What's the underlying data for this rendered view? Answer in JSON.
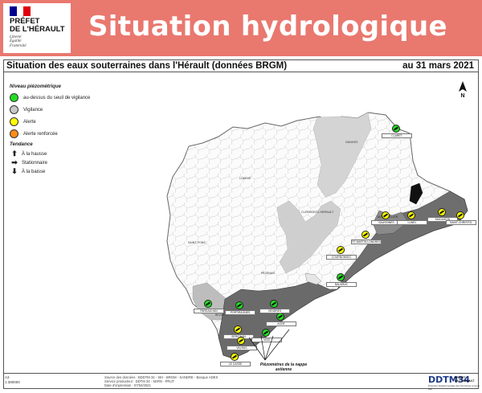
{
  "header": {
    "logo_lines": [
      "PRÉFET",
      "DE L'HÉRAULT"
    ],
    "logo_motto": [
      "Liberté",
      "Égalité",
      "Fraternité"
    ],
    "banner_title": "Situation hydrologique",
    "colors": {
      "banner": "#e9786f",
      "flag_blue": "#000091",
      "flag_red": "#e1000f"
    }
  },
  "map": {
    "title": "Situation des eaux souterraines dans l'Hérault (données BRGM)",
    "date": "au 31 mars 2021",
    "north_label": "N"
  },
  "legend": {
    "level_title": "Niveau piézométrique",
    "levels": [
      {
        "label": "au-dessus du seuil de vigilance",
        "color": "#22dd22"
      },
      {
        "label": "Vigilance",
        "color": "#c8c8c8"
      },
      {
        "label": "Alerte",
        "color": "#ffff00"
      },
      {
        "label": "Alerte renforcée",
        "color": "#ff8c1a"
      }
    ],
    "trend_title": "Tendance",
    "trends": [
      {
        "label": "À la hausse",
        "glyph": "⬆"
      },
      {
        "label": "Stationnaire",
        "glyph": "➡"
      },
      {
        "label": "À la baisse",
        "glyph": "⬇"
      }
    ]
  },
  "stations": [
    {
      "label": "CLARET",
      "status": "green"
    },
    {
      "label": "SAUSSINES",
      "status": "yellow"
    },
    {
      "label": "LUNEL",
      "status": "yellow"
    },
    {
      "label": "MUDAISON",
      "status": "yellow"
    },
    {
      "label": "SAINT-CHRISTOL",
      "status": "yellow"
    },
    {
      "label": "ST MARTIN LONDRES",
      "status": "yellow"
    },
    {
      "label": "COURNONSEC",
      "status": "yellow"
    },
    {
      "label": "BALARUC",
      "status": "green"
    },
    {
      "label": "PARDAILHAN",
      "status": "green"
    },
    {
      "label": "SERIGNAN",
      "status": "yellow"
    },
    {
      "label": "VIAS",
      "status": "green"
    },
    {
      "label": "AGDE",
      "status": "green"
    },
    {
      "label": "VENDRES",
      "status": "green"
    },
    {
      "label": "VALRAS",
      "status": "yellow"
    },
    {
      "label": "LE CASSE",
      "status": "yellow"
    },
    {
      "label": "PORTIRAGNES",
      "status": "green"
    }
  ],
  "towns": [
    "LODEVE",
    "SAINT-PONS",
    "BEZIERS",
    "PEZENAS",
    "MONTPELLIER",
    "GANGES",
    "CLERMONT-L'HERAULT"
  ],
  "annotation": "Piézomètres de la nappe astienne",
  "footer": {
    "scale": [
      "A3",
      "1:380000"
    ],
    "source": [
      "Source des données : BDDTM 34 - SIH - BRGM - SANDRE - Banque ADES",
      "Service producteur : DDTM 34 - SERN - PRUT",
      "Date d'impression : 07/04/2021"
    ],
    "ddtm_label": "DDTM34",
    "ddtm_sub": "Direction départementale des Territoires et de la Mer",
    "pref_mini": [
      "PRÉFET",
      "DE L'HÉRAULT"
    ]
  }
}
